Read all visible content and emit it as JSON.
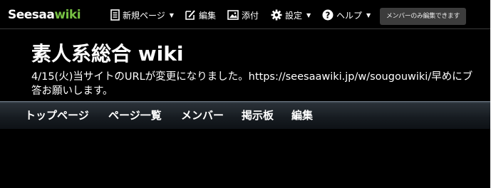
{
  "toolbar": {
    "logo_part1": "Seesaa",
    "logo_part2": "wiki",
    "new_page_label": "新規ページ",
    "edit_label": "編集",
    "attach_label": "添付",
    "settings_label": "設定",
    "help_label": "ヘルプ",
    "member_edit_label": "メンバーのみ編集できます"
  },
  "header": {
    "site_title": "素人系総合 wiki",
    "notice_line1": "4/15(火)当サイトのURLが変更になりました。https://seesaawiki.jp/w/sougouwiki/早めにブ",
    "notice_line2": "答お願いします。"
  },
  "nav": {
    "items": [
      "トップページ",
      "ページ一覧",
      "メンバー",
      "掲示板",
      "編集"
    ]
  },
  "icons": [
    "page-icon",
    "edit-icon",
    "image-icon",
    "gear-icon",
    "help-icon",
    "caret-down-icon"
  ],
  "colors": {
    "background": "#000000",
    "logo_accent": "#76c043",
    "member_button_bg": "#3c3c3c"
  }
}
